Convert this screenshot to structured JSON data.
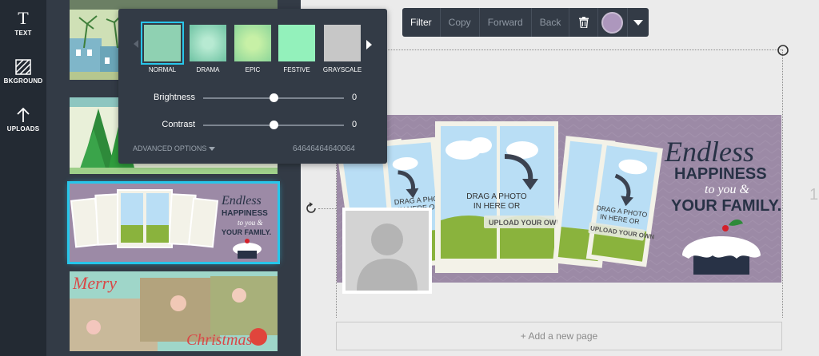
{
  "rail": {
    "items": [
      {
        "label": "TEXT",
        "icon": "text-icon"
      },
      {
        "label": "BKGROUND",
        "icon": "background-icon"
      },
      {
        "label": "UPLOADS",
        "icon": "upload-arrow-icon"
      }
    ]
  },
  "filter_popup": {
    "filters": [
      {
        "label": "NORMAL",
        "color": "#8fd1b2"
      },
      {
        "label": "DRAMA",
        "color": "#7fcfb0"
      },
      {
        "label": "EPIC",
        "color": "#a4e3a6"
      },
      {
        "label": "FESTIVE",
        "color": "#93f1bb"
      },
      {
        "label": "GRAYSCALE",
        "color": "#c7c7c7"
      }
    ],
    "selected": "NORMAL",
    "brightness": {
      "label": "Brightness",
      "value": "0",
      "fraction": 0.5
    },
    "contrast": {
      "label": "Contrast",
      "value": "0",
      "fraction": 0.5
    },
    "advanced_label": "ADVANCED OPTIONS",
    "code": "64646464640064"
  },
  "toolbar": {
    "filter": "Filter",
    "copy": "Copy",
    "forward": "Forward",
    "back": "Back",
    "color": "#ad97bd"
  },
  "thumbnails": {
    "merry_text": "Merry",
    "christmas_text": "Christmas",
    "endless_text": "Endless",
    "happiness_text": "HAPPINESS",
    "to_you_text": "to you &",
    "family_text": "YOUR FAMILY."
  },
  "design": {
    "endless": "Endless",
    "happiness": "HAPPINESS",
    "to_you": "to you &",
    "your_family": "YOUR FAMILY.",
    "drag_small_1": "DRAG A PHOTO",
    "drag_small_2": "IN HERE OR",
    "drag_center_1": "DRAG A PHOTO",
    "drag_center_2": "IN HERE OR",
    "upload_center": "UPLOAD YOUR OWN",
    "drag_right_1": "DRAG A PHOTO",
    "drag_right_2": "IN HERE OR",
    "upload_right": "UPLOAD YOUR OWN",
    "accent_color": "#9c8aa6"
  },
  "canvas": {
    "add_page": "+ Add a new page",
    "page_number": "1"
  }
}
